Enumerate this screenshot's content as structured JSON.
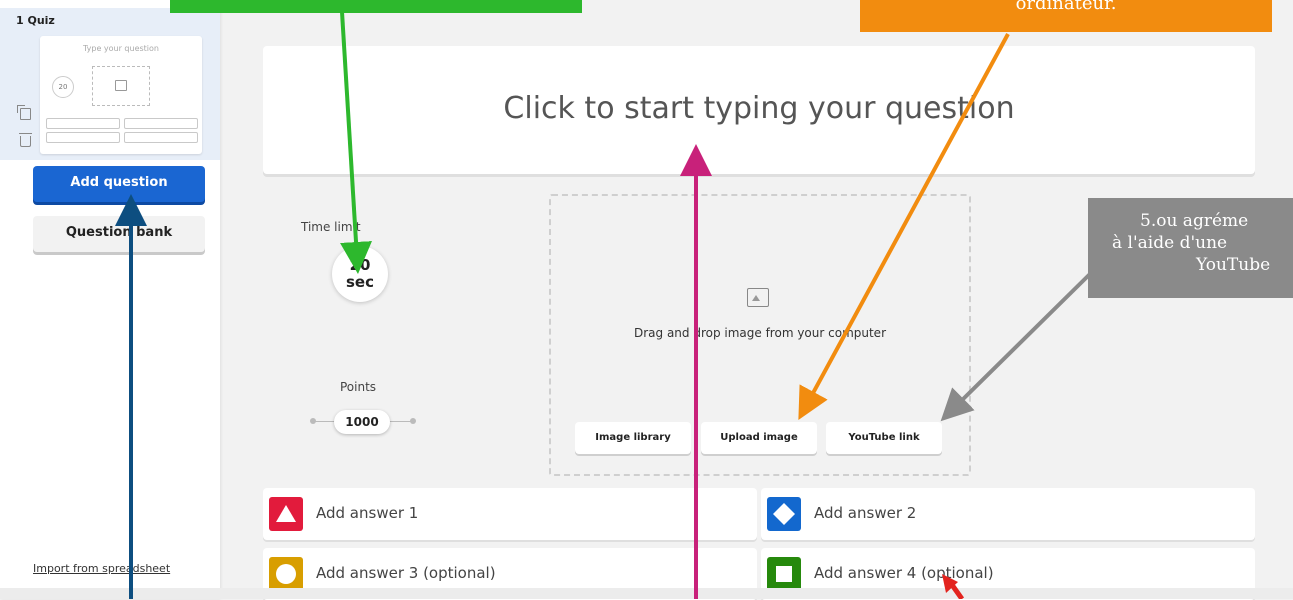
{
  "sidebar": {
    "slide_title": "1 Quiz",
    "thumbnail": {
      "question_placeholder": "Type your question",
      "time": "20"
    },
    "add_question": "Add question",
    "question_bank": "Question bank",
    "import_link": "Import from spreadsheet"
  },
  "question": {
    "placeholder": "Click to start typing your question"
  },
  "settings": {
    "time_limit_label": "Time limit",
    "time_value": "20",
    "time_unit": "sec",
    "points_label": "Points",
    "points_value": "1000"
  },
  "media": {
    "drop_text": "Drag and drop image from your computer",
    "buttons": [
      "Image library",
      "Upload image",
      "YouTube link"
    ]
  },
  "answers": [
    {
      "label": "Add answer 1",
      "color": "#e21b3c",
      "shape": "triangle"
    },
    {
      "label": "Add answer 2",
      "color": "#1368ce",
      "shape": "diamond"
    },
    {
      "label": "Add answer 3 (optional)",
      "color": "#d89e00",
      "shape": "circle"
    },
    {
      "label": "Add answer 4 (optional)",
      "color": "#26890c",
      "shape": "square"
    }
  ],
  "annotations": {
    "orange_text": "ordinateur.",
    "gray_lines": [
      "5.ou agréme",
      "à l'aide d'une",
      "YouTube"
    ],
    "colors": {
      "green": "#2db82d",
      "orange": "#f28c0f",
      "gray": "#8a8a8a",
      "navy": "#0d4e80",
      "magenta": "#c8217a",
      "red": "#e3231e"
    }
  }
}
